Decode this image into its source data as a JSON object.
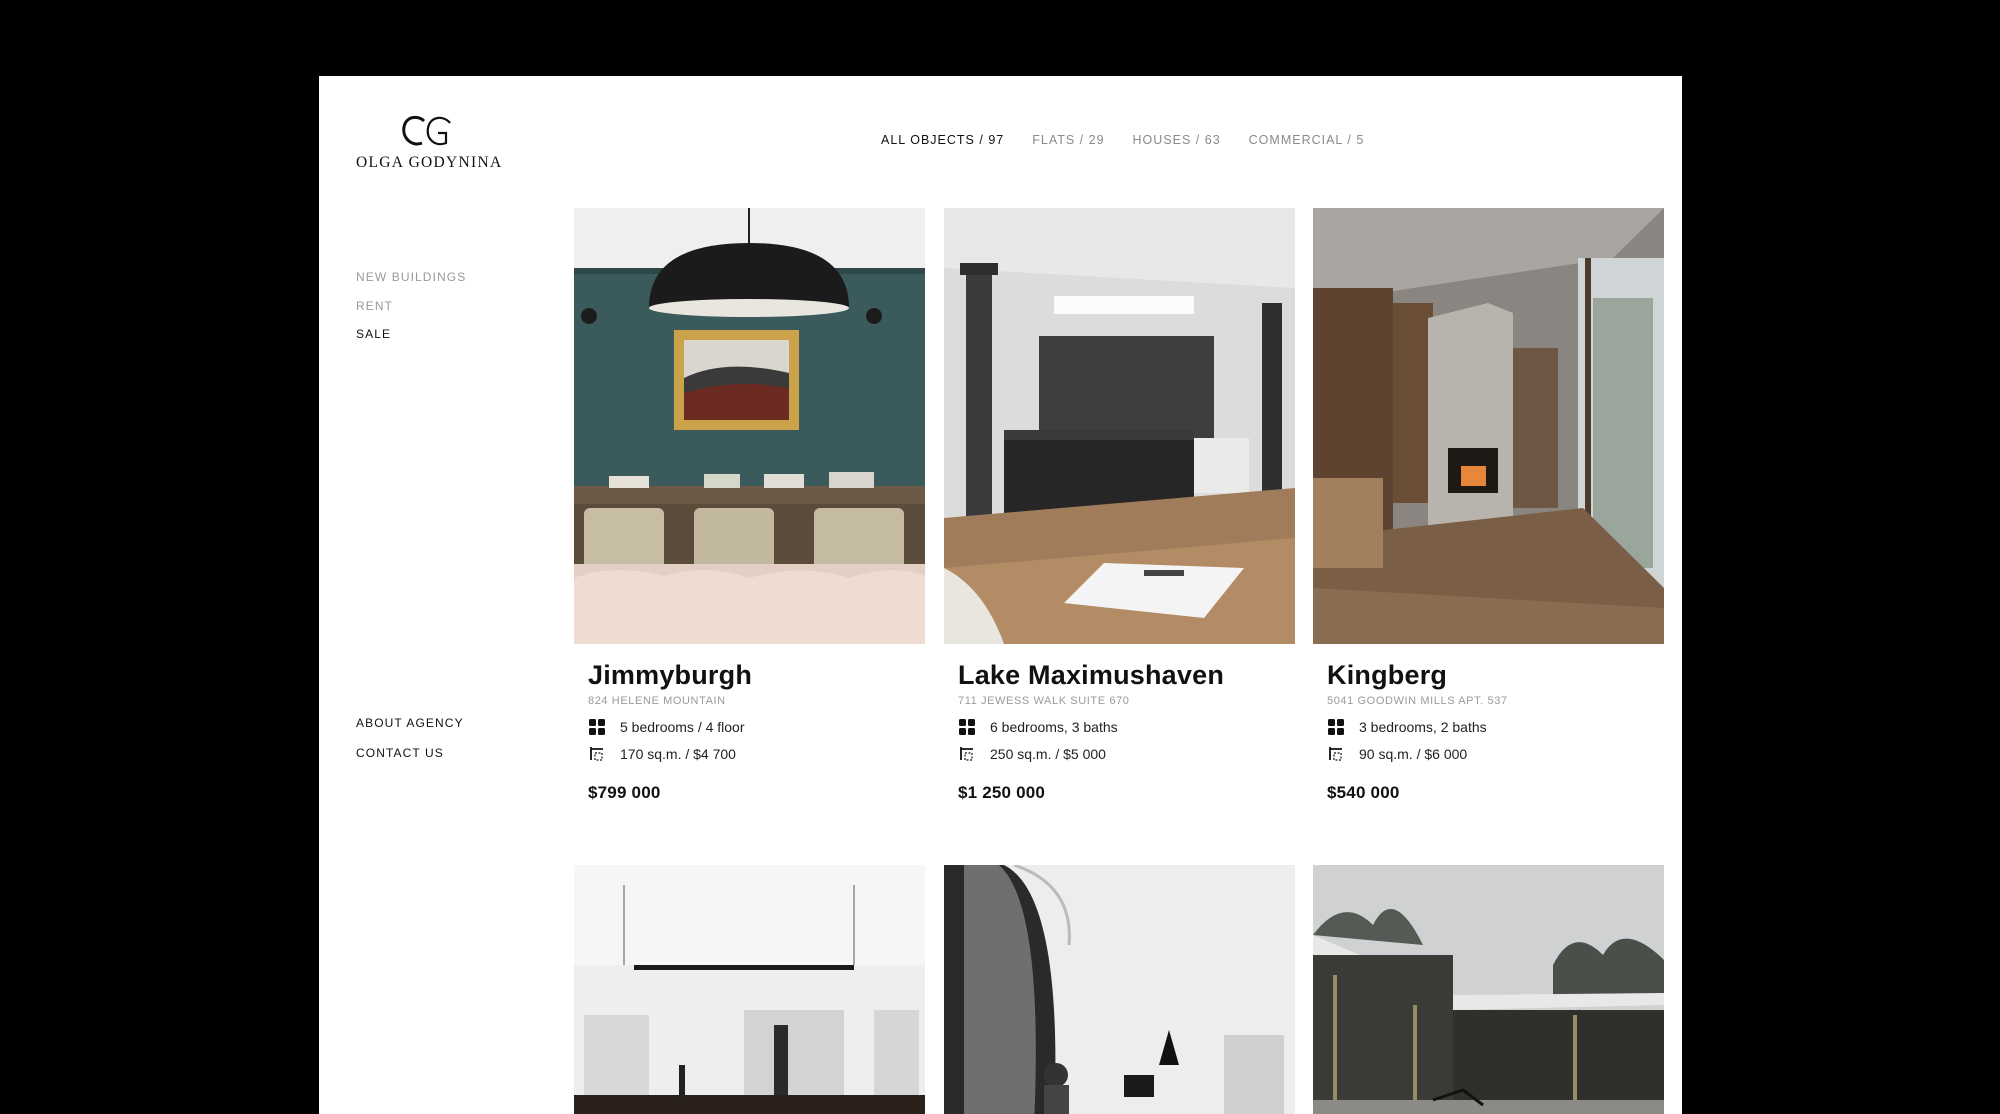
{
  "brand": {
    "name": "OLGA GODYNINA"
  },
  "filters": [
    {
      "label": "ALL OBJECTS / 97",
      "active": true
    },
    {
      "label": "FLATS / 29",
      "active": false
    },
    {
      "label": "HOUSES / 63",
      "active": false
    },
    {
      "label": "COMMERCIAL / 5",
      "active": false
    }
  ],
  "sidebar": {
    "categories": [
      {
        "label": "NEW BUILDINGS",
        "active": false
      },
      {
        "label": "RENT",
        "active": false
      },
      {
        "label": "SALE",
        "active": true
      }
    ],
    "links": [
      {
        "label": "ABOUT AGENCY"
      },
      {
        "label": "CONTACT US"
      }
    ]
  },
  "listings": [
    {
      "title": "Jimmyburgh",
      "address": "824 HELENE MOUNTAIN",
      "rooms": "5 bedrooms / 4 floor",
      "area": "170 sq.m. / $4 700",
      "price": "$799 000",
      "image": "dining-room-photo"
    },
    {
      "title": "Lake Maximushaven",
      "address": "711 JEWESS WALK SUITE 670",
      "rooms": "6 bedrooms, 3 baths",
      "area": "250 sq.m. / $5 000",
      "price": "$1 250 000",
      "image": "loft-kitchen-photo"
    },
    {
      "title": "Kingberg",
      "address": "5041 GOODWIN MILLS APT. 537",
      "rooms": "3 bedrooms, 2 baths",
      "area": "90 sq.m. / $6 000",
      "price": "$540 000",
      "image": "concrete-fireplace-photo"
    },
    {
      "image": "white-kitchen-photo"
    },
    {
      "image": "curved-interior-photo"
    },
    {
      "image": "courtyard-pool-photo"
    }
  ],
  "icons": {
    "rooms": "grid-icon",
    "area": "area-icon"
  }
}
